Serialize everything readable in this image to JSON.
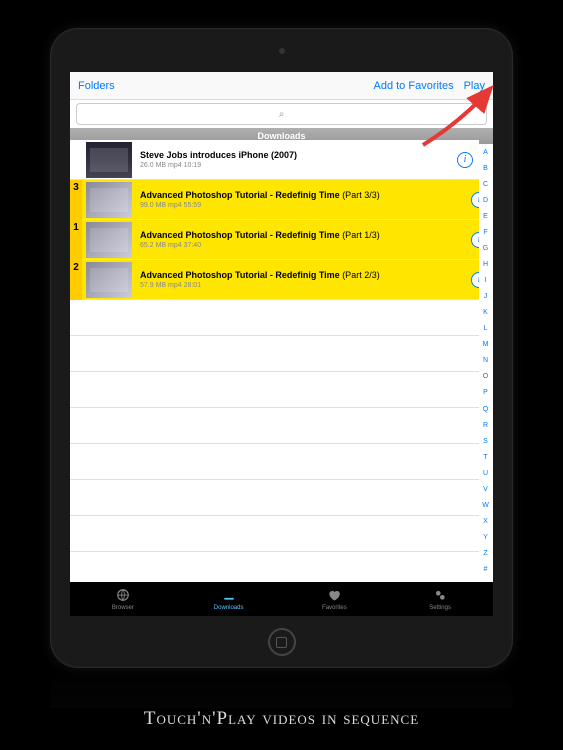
{
  "nav": {
    "back": "Folders",
    "favorites": "Add to Favorites",
    "play": "Play"
  },
  "search": {
    "icon": "⌕"
  },
  "section_header": "Downloads",
  "items": [
    {
      "badge": "",
      "title": "Steve Jobs introduces iPhone (2007)",
      "part": "",
      "size": "26.0 MB",
      "format": "mp4",
      "duration": "10:19",
      "selected": false,
      "dark": true
    },
    {
      "badge": "3",
      "title": "Advanced Photoshop Tutorial - Redefinig Time",
      "part": "(Part 3/3)",
      "size": "99.0 MB",
      "format": "mp4",
      "duration": "55:59",
      "selected": true,
      "dark": false
    },
    {
      "badge": "1",
      "title": "Advanced Photoshop Tutorial - Redefinig Time",
      "part": "(Part 1/3)",
      "size": "65.2 MB",
      "format": "mp4",
      "duration": "37:40",
      "selected": true,
      "dark": false
    },
    {
      "badge": "2",
      "title": "Advanced Photoshop Tutorial - Redefinig Time",
      "part": "(Part 2/3)",
      "size": "57.9 MB",
      "format": "mp4",
      "duration": "28:01",
      "selected": true,
      "dark": false
    }
  ],
  "index_letters": [
    "A",
    "B",
    "C",
    "D",
    "E",
    "F",
    "G",
    "H",
    "I",
    "J",
    "K",
    "L",
    "M",
    "N",
    "O",
    "P",
    "Q",
    "R",
    "S",
    "T",
    "U",
    "V",
    "W",
    "X",
    "Y",
    "Z",
    "#"
  ],
  "tabs": [
    {
      "label": "Browser",
      "active": false
    },
    {
      "label": "Downloads",
      "active": true
    },
    {
      "label": "Favorites",
      "active": false
    },
    {
      "label": "Settings",
      "active": false
    }
  ],
  "caption": "Touch'n'Play videos in sequence"
}
